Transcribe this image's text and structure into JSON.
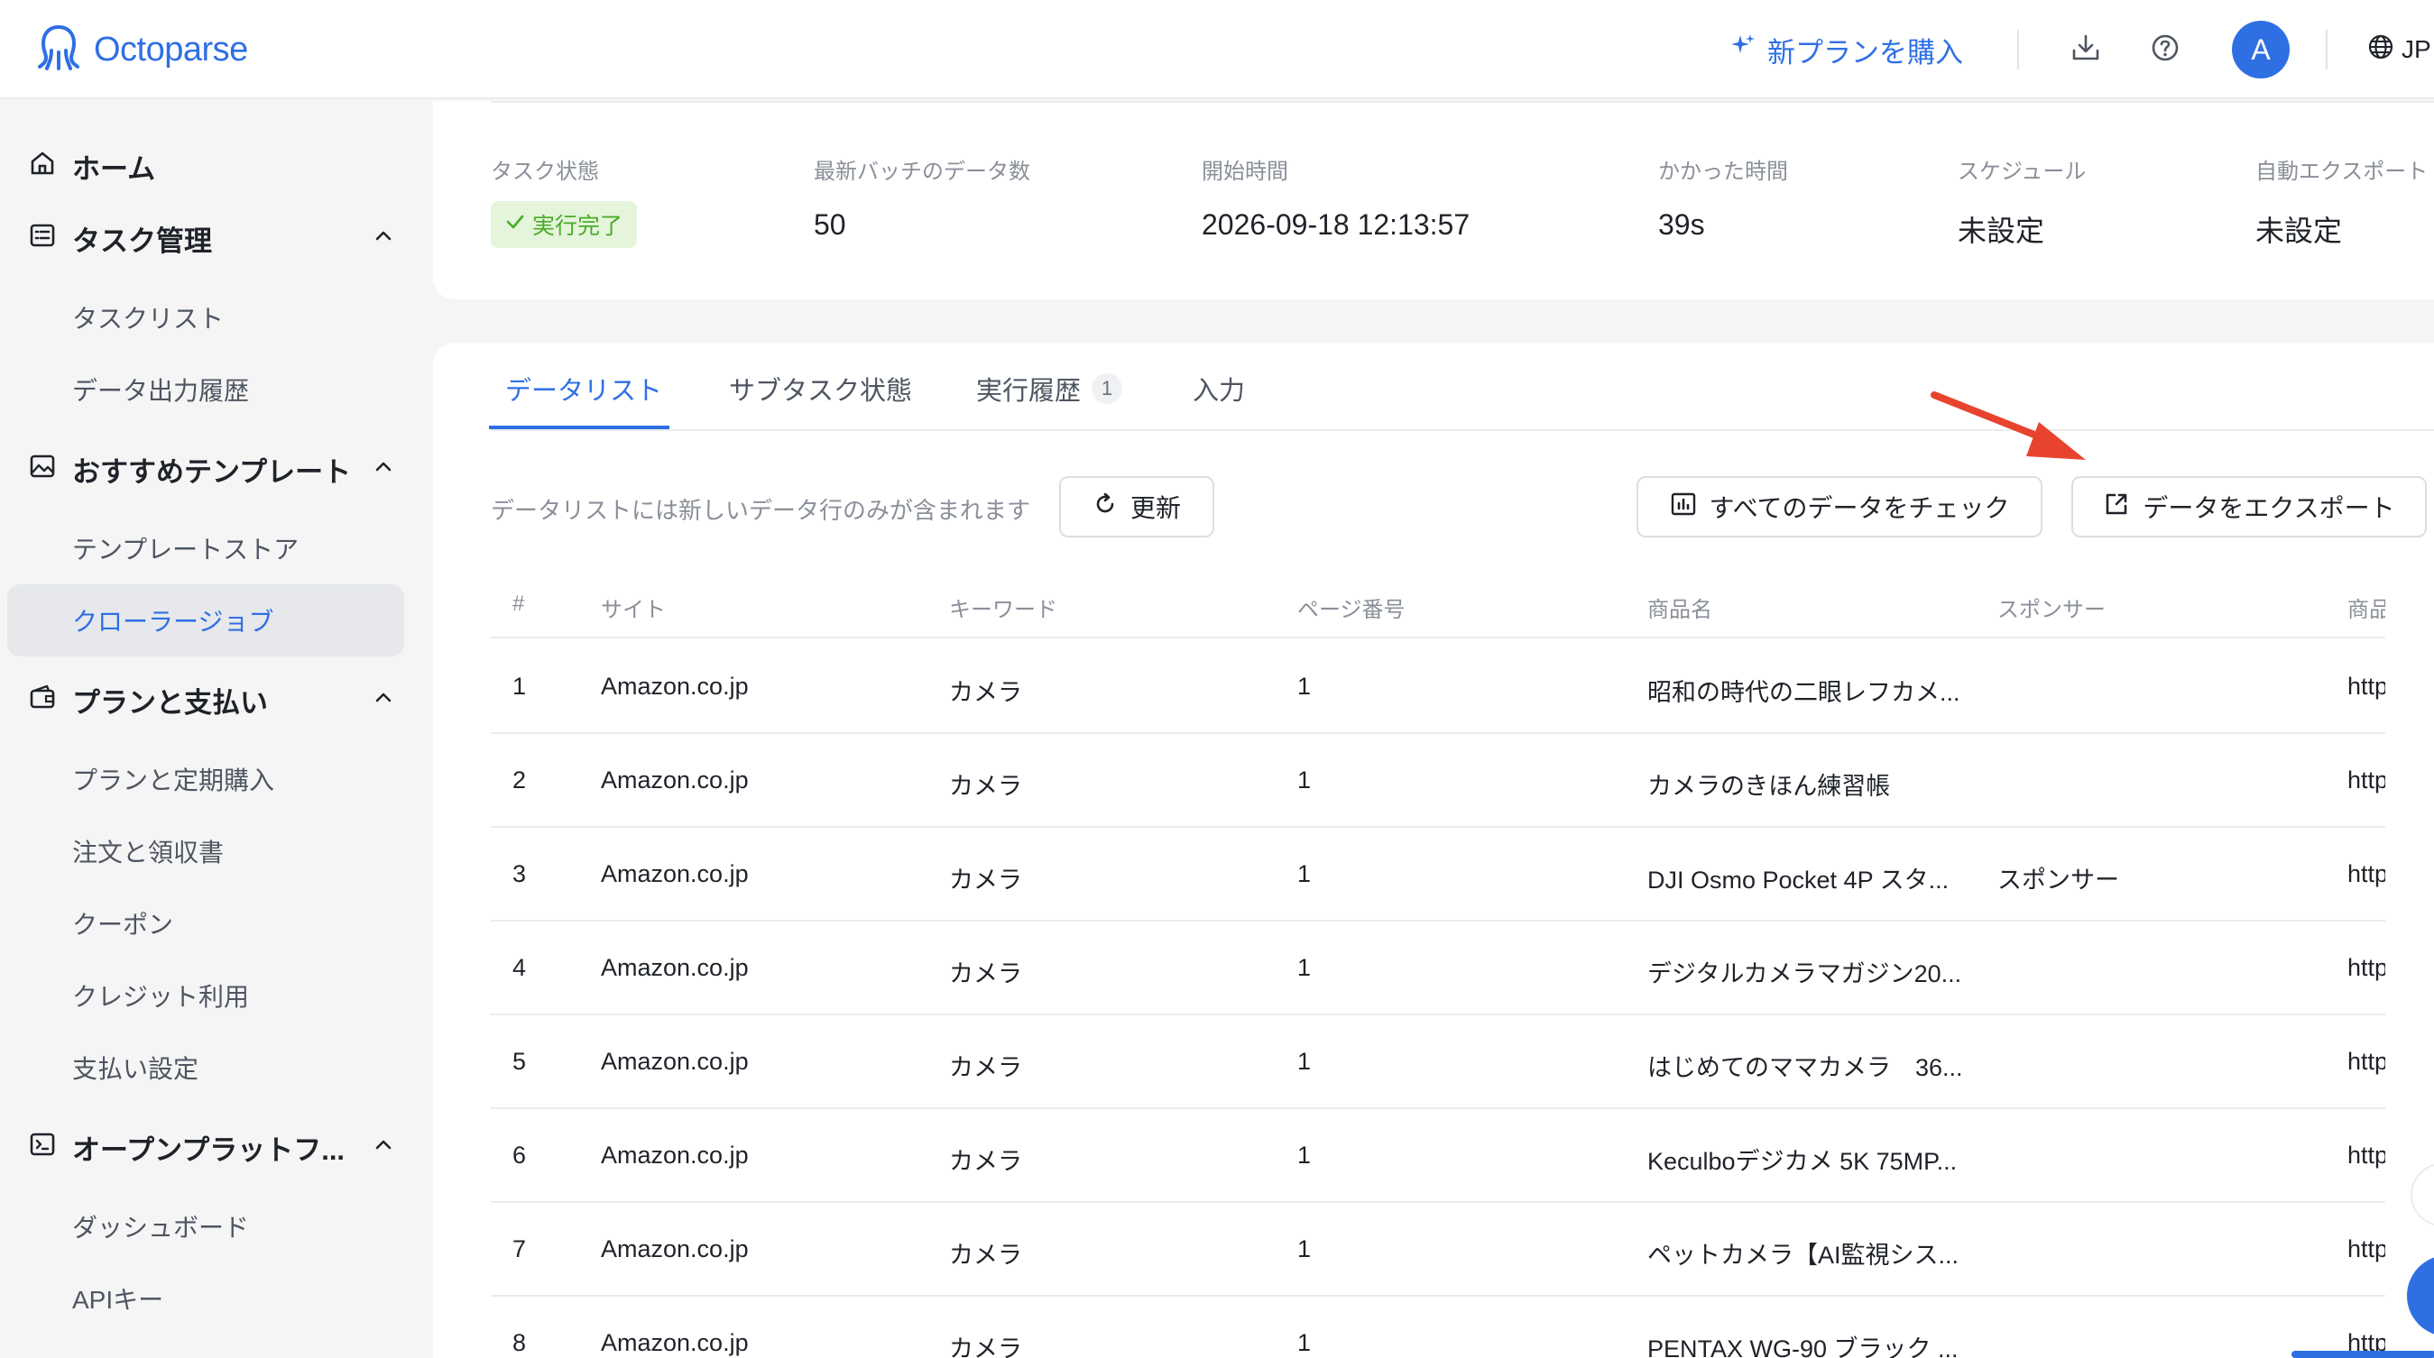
{
  "header": {
    "logo_text": "Octoparse",
    "buy_plan": "新プランを購入",
    "avatar_initial": "A",
    "language": "JP"
  },
  "sidebar": {
    "home": "ホーム",
    "task_mgmt": "タスク管理",
    "task_list": "タスクリスト",
    "export_history": "データ出力履歴",
    "templates": "おすすめテンプレート",
    "template_store": "テンプレートストア",
    "crawler_jobs": "クローラージョブ",
    "plans": "プランと支払い",
    "plan_subscription": "プランと定期購入",
    "orders": "注文と領収書",
    "coupons": "クーポン",
    "credit_usage": "クレジット利用",
    "payment_settings": "支払い設定",
    "open_platform": "オープンプラットフ...",
    "dashboard": "ダッシュボード",
    "api_key": "APIキー"
  },
  "stats": {
    "task_status_label": "タスク状態",
    "task_status_value": "実行完了",
    "latest_count_label": "最新バッチのデータ数",
    "latest_count_value": "50",
    "start_time_label": "開始時間",
    "start_time_value": "2026-09-18 12:13:57",
    "elapsed_label": "かかった時間",
    "elapsed_value": "39s",
    "schedule_label": "スケジュール",
    "schedule_value": "未設定",
    "auto_export_label": "自動エクスポート",
    "auto_export_value": "未設定"
  },
  "tabs": {
    "data_list": "データリスト",
    "subtask_status": "サブタスク状態",
    "run_history": "実行履歴",
    "run_history_count": "1",
    "input": "入力"
  },
  "toolbar": {
    "hint": "データリストには新しいデータ行のみが含まれます",
    "refresh": "更新",
    "check_all": "すべてのデータをチェック",
    "export": "データをエクスポート"
  },
  "table": {
    "headers": [
      "#",
      "サイト",
      "キーワード",
      "ページ番号",
      "商品名",
      "スポンサー",
      "商品"
    ],
    "rows": [
      [
        "1",
        "Amazon.co.jp",
        "カメラ",
        "1",
        "昭和の時代の二眼レフカメ...",
        "",
        "http"
      ],
      [
        "2",
        "Amazon.co.jp",
        "カメラ",
        "1",
        "カメラのきほん練習帳",
        "",
        "http"
      ],
      [
        "3",
        "Amazon.co.jp",
        "カメラ",
        "1",
        "DJI Osmo Pocket 4P スタ...",
        "スポンサー",
        "http"
      ],
      [
        "4",
        "Amazon.co.jp",
        "カメラ",
        "1",
        "デジタルカメラマガジン20...",
        "",
        "http"
      ],
      [
        "5",
        "Amazon.co.jp",
        "カメラ",
        "1",
        "はじめてのママカメラ　36...",
        "",
        "http"
      ],
      [
        "6",
        "Amazon.co.jp",
        "カメラ",
        "1",
        "Keculboデジカメ 5K 75MP...",
        "",
        "http"
      ],
      [
        "7",
        "Amazon.co.jp",
        "カメラ",
        "1",
        "ペットカメラ【AI監視シス...",
        "",
        "http"
      ],
      [
        "8",
        "Amazon.co.jp",
        "カメラ",
        "1",
        "PENTAX WG-90 ブラック ...",
        "",
        "http"
      ]
    ]
  },
  "colors": {
    "accent": "#2f6fe4",
    "success_bg": "#e4f5dc",
    "success_text": "#4caa28",
    "annotation_arrow": "#e8432f"
  }
}
